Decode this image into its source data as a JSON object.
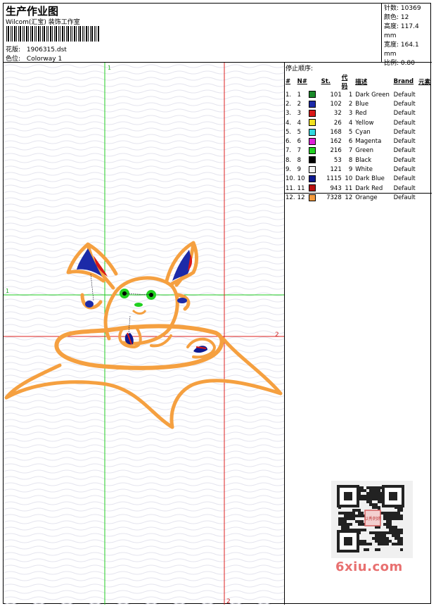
{
  "header": {
    "title": "生产作业图",
    "subtitle": "Wilcom(汇宝) 装饰工作室",
    "design_label": "花版:",
    "design_value": "1906315.dst",
    "color_label": "色位:",
    "color_value": "Colorway 1"
  },
  "stats": {
    "stitches_label": "针数:",
    "stitches_value": "10369",
    "colors_label": "颜色:",
    "colors_value": "12",
    "height_label": "高度:",
    "height_value": "117.4 mm",
    "width_label": "宽度:",
    "width_value": "164.1 mm",
    "scale_label": "比例:",
    "scale_value": "0.80"
  },
  "canvas": {
    "marker_top": "1",
    "marker_left": "1",
    "marker_right": "2",
    "marker_bottom": "2"
  },
  "stop_sequence": {
    "title": "停止顺序:",
    "headers": {
      "idx": "#",
      "no": "N#",
      "st": "St.",
      "code": "代码",
      "desc": "描述",
      "brand": "Brand",
      "elem": "元素"
    },
    "rows": [
      {
        "idx": "1.",
        "no": "1",
        "color": "#1a8a2a",
        "st": "101",
        "code": "1",
        "desc": "Dark Green",
        "brand": "Default"
      },
      {
        "idx": "2.",
        "no": "2",
        "color": "#1c2aa8",
        "st": "102",
        "code": "2",
        "desc": "Blue",
        "brand": "Default"
      },
      {
        "idx": "3.",
        "no": "3",
        "color": "#d81818",
        "st": "32",
        "code": "3",
        "desc": "Red",
        "brand": "Default"
      },
      {
        "idx": "4.",
        "no": "4",
        "color": "#f0e020",
        "st": "26",
        "code": "4",
        "desc": "Yellow",
        "brand": "Default"
      },
      {
        "idx": "5.",
        "no": "5",
        "color": "#30d8e0",
        "st": "168",
        "code": "5",
        "desc": "Cyan",
        "brand": "Default"
      },
      {
        "idx": "6.",
        "no": "6",
        "color": "#e020d8",
        "st": "162",
        "code": "6",
        "desc": "Magenta",
        "brand": "Default"
      },
      {
        "idx": "7.",
        "no": "7",
        "color": "#20d020",
        "st": "216",
        "code": "7",
        "desc": "Green",
        "brand": "Default"
      },
      {
        "idx": "8.",
        "no": "8",
        "color": "#000000",
        "st": "53",
        "code": "8",
        "desc": "Black",
        "brand": "Default"
      },
      {
        "idx": "9.",
        "no": "9",
        "color": "#f4f4f4",
        "st": "121",
        "code": "9",
        "desc": "White",
        "brand": "Default"
      },
      {
        "idx": "10.",
        "no": "10",
        "color": "#0c1890",
        "st": "1115",
        "code": "10",
        "desc": "Dark Blue",
        "brand": "Default"
      },
      {
        "idx": "11.",
        "no": "11",
        "color": "#b81010",
        "st": "943",
        "code": "11",
        "desc": "Dark Red",
        "brand": "Default"
      },
      {
        "idx": "12.",
        "no": "12",
        "color": "#f59a3c",
        "st": "7328",
        "code": "12",
        "desc": "Orange",
        "brand": "Default"
      }
    ]
  },
  "watermark": {
    "site": "6xiu.com",
    "seal": "以秀刺绣"
  }
}
